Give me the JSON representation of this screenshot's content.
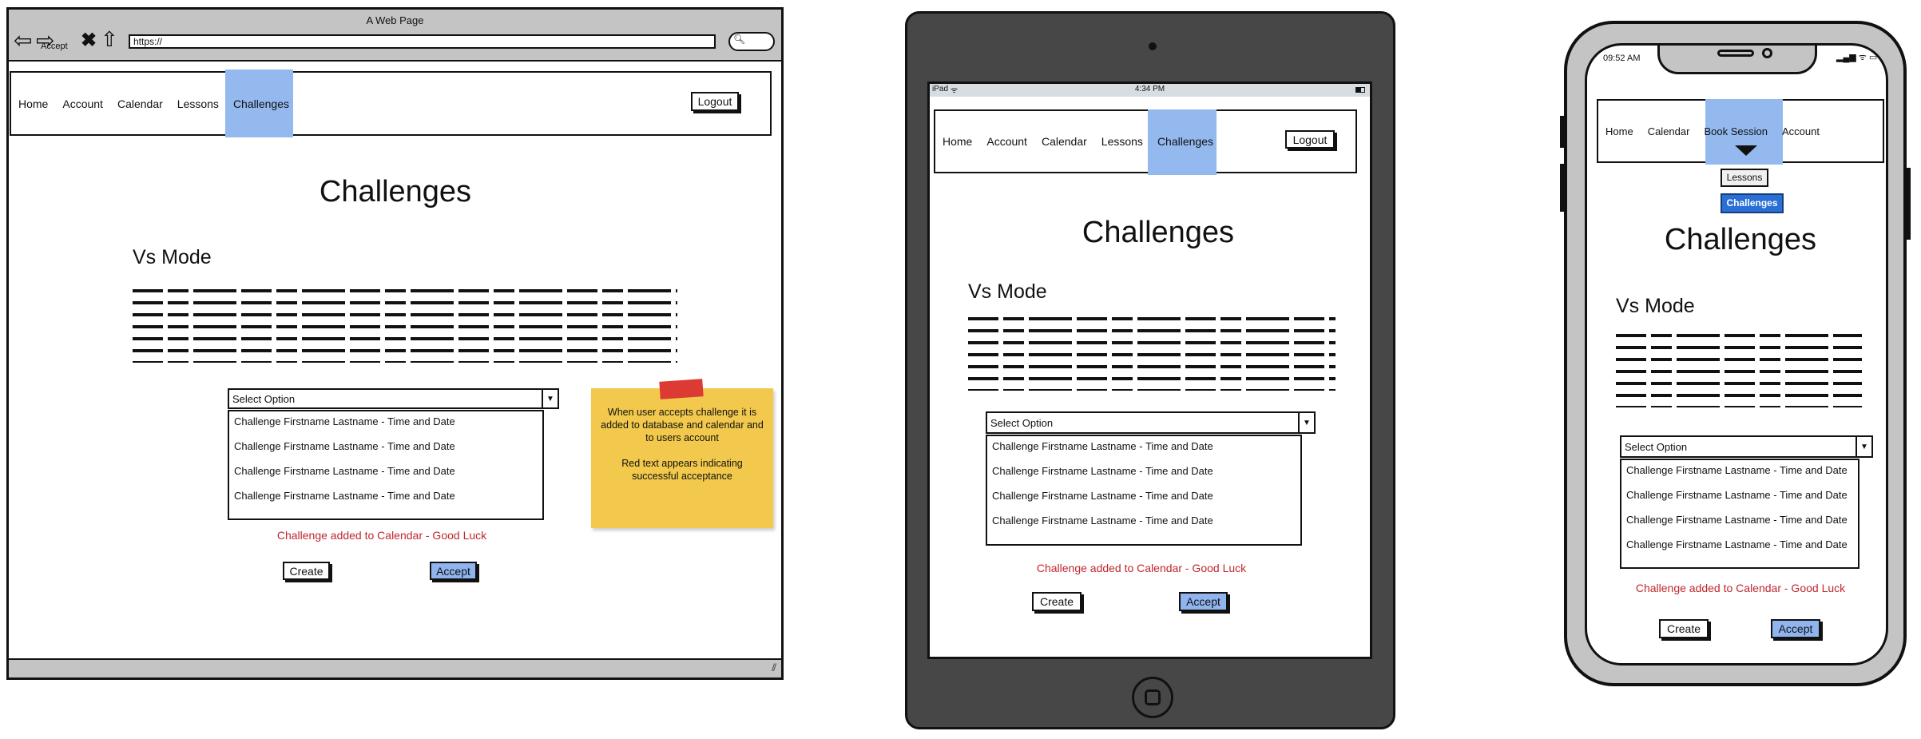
{
  "desktop": {
    "window_title": "A Web Page",
    "url": "https://",
    "stray_label": "Accept",
    "nav": [
      "Home",
      "Account",
      "Calendar",
      "Lessons",
      "Challenges"
    ],
    "logout": "Logout",
    "heading": "Challenges",
    "subheading": "Vs Mode",
    "select_placeholder": "Select Option",
    "options": [
      "Challenge Firstname Lastname - Time and Date",
      "Challenge Firstname Lastname - Time and Date",
      "Challenge Firstname Lastname - Time and Date",
      "Challenge Firstname Lastname - Time and Date"
    ],
    "success": "Challenge added to Calendar - Good Luck",
    "create": "Create",
    "accept": "Accept",
    "note": [
      "When user accepts challenge it is added to database and calendar and to users account",
      "Red text appears indicating successful acceptance"
    ]
  },
  "tablet": {
    "status_left": "iPad",
    "status_time": "4:34 PM",
    "nav": [
      "Home",
      "Account",
      "Calendar",
      "Lessons",
      "Challenges"
    ],
    "logout": "Logout",
    "heading": "Challenges",
    "subheading": "Vs Mode",
    "select_placeholder": "Select Option",
    "options": [
      "Challenge Firstname Lastname - Time and Date",
      "Challenge Firstname Lastname - Time and Date",
      "Challenge Firstname Lastname - Time and Date",
      "Challenge Firstname Lastname - Time and Date"
    ],
    "success": "Challenge added to Calendar - Good Luck",
    "create": "Create",
    "accept": "Accept"
  },
  "phone": {
    "status_time": "09:52 AM",
    "nav": [
      "Home",
      "Calendar",
      "Book Session",
      "Account"
    ],
    "dropdown": [
      "Lessons",
      "Challenges"
    ],
    "heading": "Challenges",
    "subheading": "Vs Mode",
    "select_placeholder": "Select Option",
    "options": [
      "Challenge Firstname Lastname - Time and Date",
      "Challenge Firstname Lastname - Time and Date",
      "Challenge Firstname Lastname - Time and Date",
      "Challenge Firstname Lastname - Time and Date"
    ],
    "success": "Challenge added to Calendar - Good Luck",
    "create": "Create",
    "accept": "Accept"
  },
  "colors": {
    "highlight": "#93b9ef",
    "accept": "#8fb4ee",
    "success": "#c0272d",
    "note": "#f2c94c",
    "phone_active": "#2a6fd6"
  }
}
